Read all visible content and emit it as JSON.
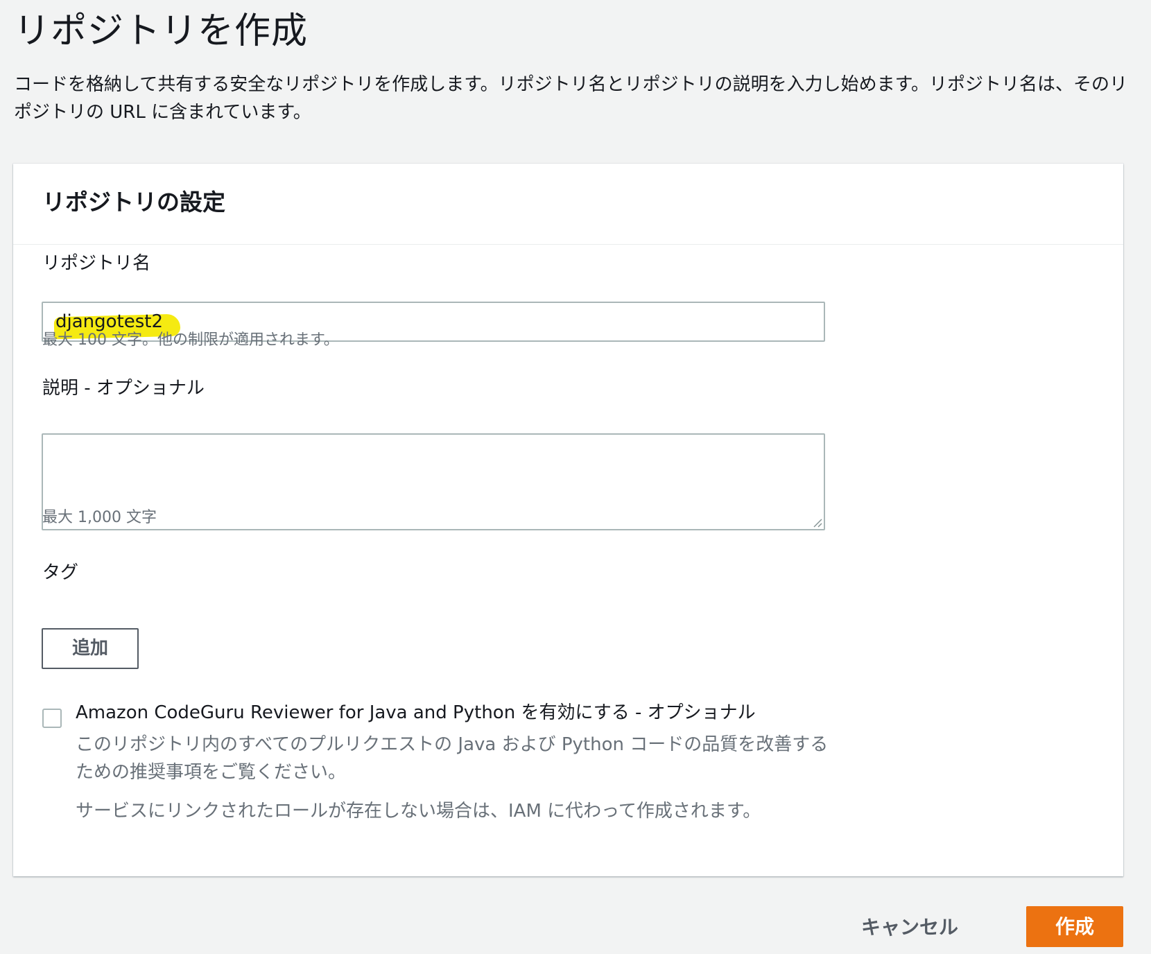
{
  "page": {
    "title": "リポジトリを作成",
    "description": "コードを格納して共有する安全なリポジトリを作成します。リポジトリ名とリポジトリの説明を入力し始めます。リポジトリ名は、そのリポジトリの URL に含まれています。"
  },
  "settings": {
    "title": "リポジトリの設定",
    "repo_name": {
      "label": "リポジトリ名",
      "value": "djangotest2",
      "hint": "最大 100 文字。他の制限が適用されます。"
    },
    "description": {
      "label": "説明 - オプショナル",
      "value": "",
      "hint": "最大 1,000 文字"
    },
    "tags": {
      "label": "タグ",
      "add_label": "追加"
    },
    "codeguru": {
      "checked": false,
      "label": "Amazon CodeGuru Reviewer for Java and Python を有効にする - オプショナル",
      "description": "このリポジトリ内のすべてのプルリクエストの Java および Python コードの品質を改善するための推奨事項をご覧ください。",
      "note": "サービスにリンクされたロールが存在しない場合は、IAM に代わって作成されます。"
    }
  },
  "actions": {
    "cancel_label": "キャンセル",
    "create_label": "作成"
  },
  "colors": {
    "background": "#f2f3f3",
    "primary_button": "#ec7211",
    "highlight": "#f5ea12",
    "hint_text": "#687078"
  }
}
